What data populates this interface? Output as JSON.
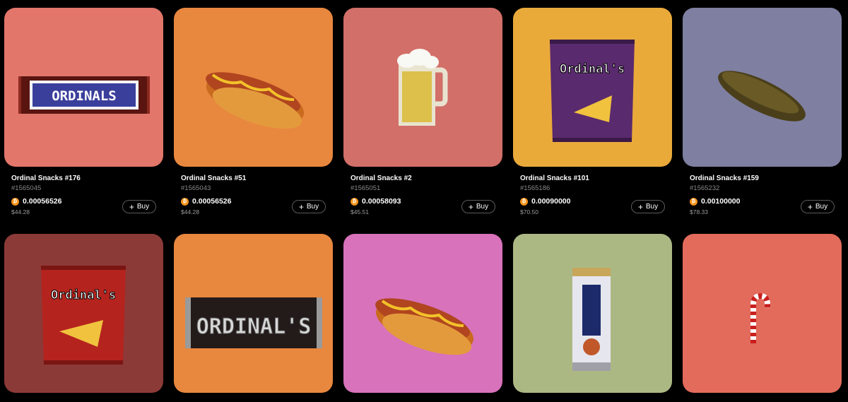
{
  "currency_symbol": "₿",
  "buy_label": "Buy",
  "plus_symbol": "+",
  "items": [
    {
      "title": "Ordinal Snacks #176",
      "inscription": "#1565045",
      "price": "0.00056526",
      "usd": "$44.28",
      "bg": "#e2766a",
      "art": "candy-bar"
    },
    {
      "title": "Ordinal Snacks #51",
      "inscription": "#1565043",
      "price": "0.00056526",
      "usd": "$44.28",
      "bg": "#e8873e",
      "art": "hot-dog"
    },
    {
      "title": "Ordinal Snacks #2",
      "inscription": "#1565051",
      "price": "0.00058093",
      "usd": "$45.51",
      "bg": "#d26f68",
      "art": "beer-mug"
    },
    {
      "title": "Ordinal Snacks #101",
      "inscription": "#1565186",
      "price": "0.00090000",
      "usd": "$70.50",
      "bg": "#eaaa3a",
      "art": "chips-purple"
    },
    {
      "title": "Ordinal Snacks #159",
      "inscription": "#1565232",
      "price": "0.00100000",
      "usd": "$78.33",
      "bg": "#7f7fa2",
      "art": "pickle"
    },
    {
      "title": "",
      "inscription": "",
      "price": "",
      "usd": "",
      "bg": "#8c3a38",
      "art": "chips-red"
    },
    {
      "title": "",
      "inscription": "",
      "price": "",
      "usd": "",
      "bg": "#e8873e",
      "art": "chocolate-bar"
    },
    {
      "title": "",
      "inscription": "",
      "price": "",
      "usd": "",
      "bg": "#d872bb",
      "art": "hot-dog"
    },
    {
      "title": "",
      "inscription": "",
      "price": "",
      "usd": "",
      "bg": "#abb884",
      "art": "beer-can"
    },
    {
      "title": "",
      "inscription": "",
      "price": "",
      "usd": "",
      "bg": "#e26b5c",
      "art": "candy-cane"
    }
  ],
  "art_text": {
    "candy_bar": "ORDINALS",
    "chips": "Ordinal's",
    "chocolate": "ORDINAL'S"
  }
}
